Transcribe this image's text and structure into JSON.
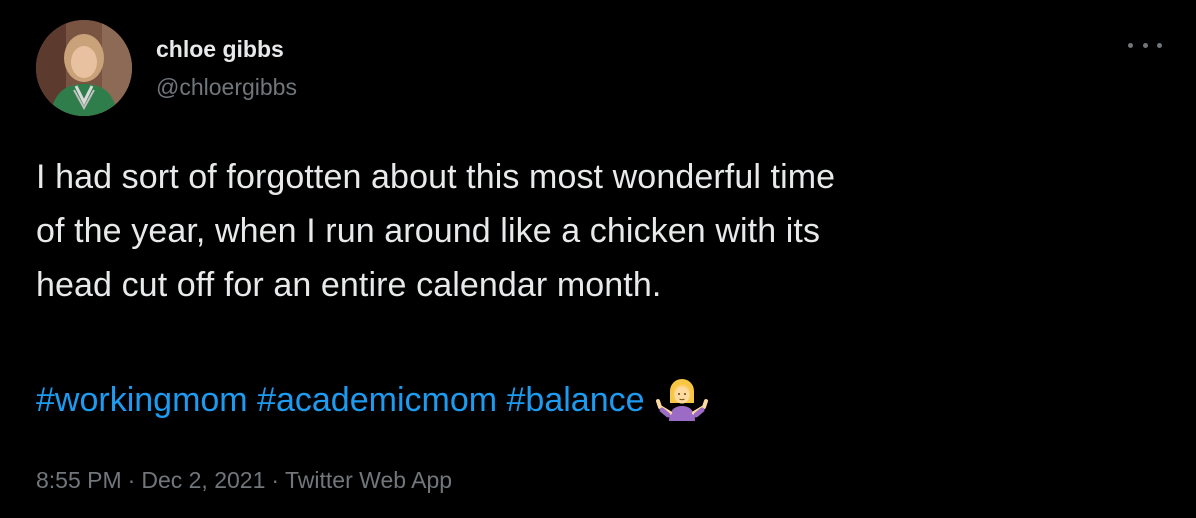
{
  "author": {
    "display_name": "chloe gibbs",
    "handle": "@chloergibbs",
    "avatar_icon": "profile-photo"
  },
  "more_icon": "more-horizontal-icon",
  "tweet": {
    "lines": [
      "I had sort of forgotten about this most wonderful time",
      "of the year, when I run around like a chicken with its",
      "head cut off for an entire calendar month."
    ],
    "hashtags": [
      "#workingmom",
      "#academicmom",
      "#balance"
    ],
    "emoji": "person-shrugging-emoji"
  },
  "meta": {
    "time": "8:55 PM",
    "separator": "·",
    "date": "Dec 2, 2021",
    "source": "Twitter Web App"
  },
  "colors": {
    "background": "#000000",
    "text": "#e7e9ea",
    "secondary": "#71767b",
    "link": "#1d9bf0"
  }
}
